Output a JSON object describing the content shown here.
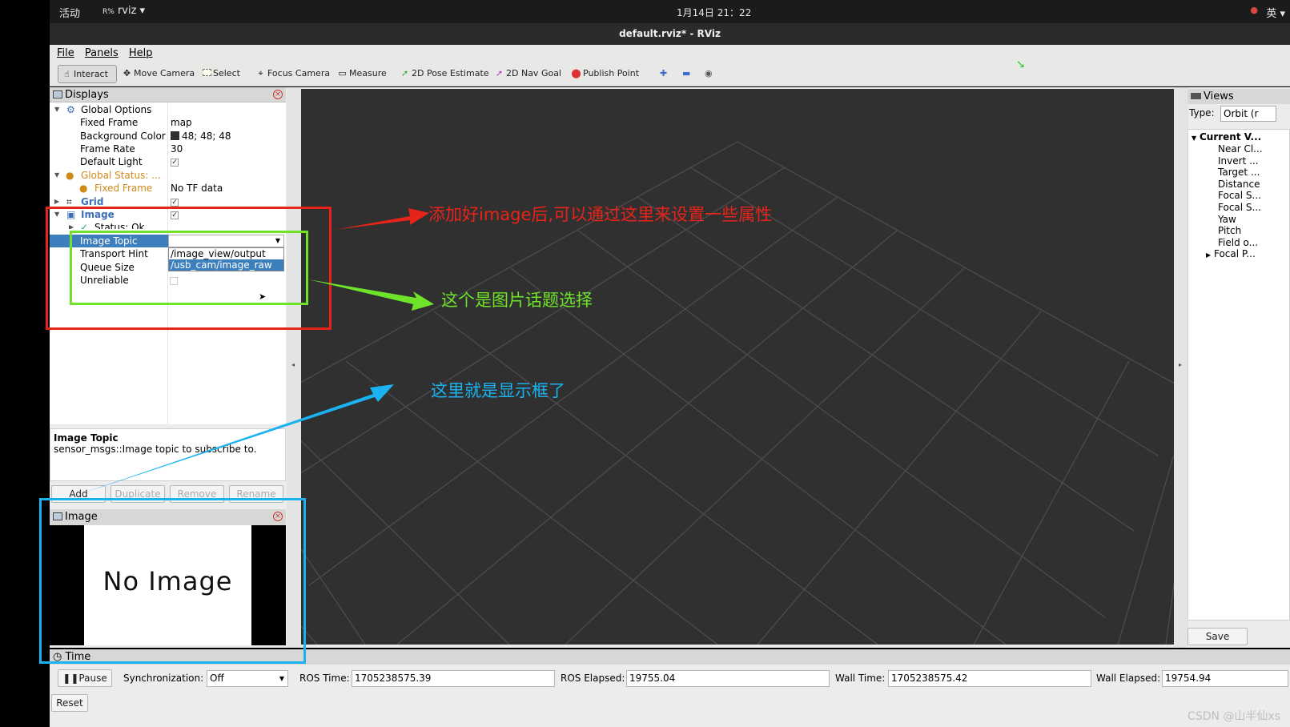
{
  "topbar": {
    "activities": "活动",
    "app": "rviz ▾",
    "clock": "1月14日  21：22",
    "ime": "英 ▾",
    "tray": "●"
  },
  "window": {
    "title": "default.rviz* - RViz"
  },
  "menu": [
    "File",
    "Panels",
    "Help"
  ],
  "toolbar": {
    "tools": [
      {
        "label": "Interact",
        "icon": "hand-icon"
      },
      {
        "label": "Move Camera",
        "icon": "move-icon"
      },
      {
        "label": "Select",
        "icon": "select-icon"
      },
      {
        "label": "Focus Camera",
        "icon": "focus-icon"
      },
      {
        "label": "Measure",
        "icon": "ruler-icon"
      },
      {
        "label": "2D Pose Estimate",
        "icon": "pose-arrow-icon"
      },
      {
        "label": "2D Nav Goal",
        "icon": "goal-arrow-icon"
      },
      {
        "label": "Publish Point",
        "icon": "pin-icon"
      }
    ],
    "active": "Interact",
    "extra_icons": [
      "plus-icon",
      "minus-icon",
      "eye-icon"
    ]
  },
  "displays": {
    "title": "Displays",
    "rows": {
      "global_options": "Global Options",
      "fixed_frame": {
        "k": "Fixed Frame",
        "v": "map"
      },
      "background_color": {
        "k": "Background Color",
        "v": "48; 48; 48"
      },
      "frame_rate": {
        "k": "Frame Rate",
        "v": "30"
      },
      "default_light": {
        "k": "Default Light"
      },
      "global_status": "Global Status: ...",
      "fixed_frame_status": {
        "k": "Fixed Frame",
        "v": "No TF data"
      },
      "grid": "Grid",
      "image": "Image",
      "status_ok": "Status: Ok",
      "image_topic": "Image Topic",
      "transport_hint": "Transport Hint",
      "queue_size": "Queue Size",
      "unreliable": "Unreliable"
    },
    "topic_options": [
      "/image_view/output",
      "/usb_cam/image_raw"
    ],
    "selected_option": "/usb_cam/image_raw",
    "description": {
      "title": "Image Topic",
      "text": "sensor_msgs::Image topic to subscribe to."
    },
    "buttons": {
      "add": "Add",
      "duplicate": "Duplicate",
      "remove": "Remove",
      "rename": "Rename"
    }
  },
  "image_panel": {
    "title": "Image",
    "placeholder": "No Image"
  },
  "views": {
    "title": "Views",
    "type_label": "Type:",
    "type_value": "Orbit (r",
    "current": "Current V...",
    "items": [
      "Near Cl...",
      "Invert ...",
      "Target ...",
      "Distance",
      "Focal S...",
      "Focal S...",
      "Yaw",
      "Pitch",
      "Field o...",
      "Focal P..."
    ],
    "save": "Save"
  },
  "time": {
    "title": "Time",
    "pause": "Pause",
    "sync_label": "Synchronization:",
    "sync_value": "Off",
    "ros_time_label": "ROS Time:",
    "ros_time": "1705238575.39",
    "ros_elapsed_label": "ROS Elapsed:",
    "ros_elapsed": "19755.04",
    "wall_time_label": "Wall Time:",
    "wall_time": "1705238575.42",
    "wall_elapsed_label": "Wall Elapsed:",
    "wall_elapsed": "19754.94",
    "reset": "Reset"
  },
  "annotations": {
    "red": "添加好image后,可以通过这里来设置一些属性",
    "green": "这个是图片话题选择",
    "blue": "这里就是显示框了",
    "colors": {
      "red": "#e8231a",
      "green": "#6ee32a",
      "blue": "#1ab2f0"
    }
  },
  "watermark": "CSDN @山半仙xs"
}
